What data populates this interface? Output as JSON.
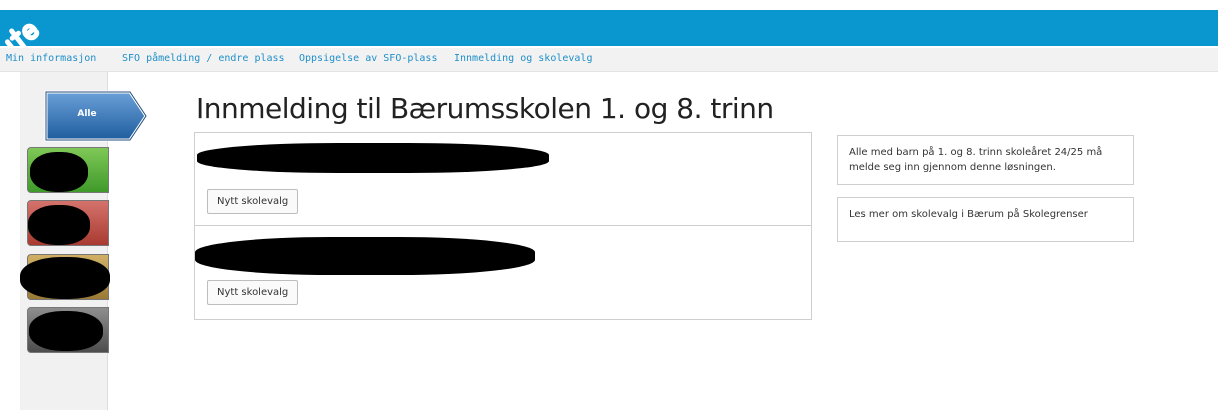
{
  "nav": {
    "items": [
      "Min informasjon",
      "SFO påmelding / endre plass",
      "Oppsigelse av SFO-plass",
      "Innmelding og skolevalg"
    ]
  },
  "sidebar": {
    "active_tab": "Alle",
    "tab_colors": [
      "#3f9a2a",
      "#a93a31",
      "#9a7a35",
      "#4d4d4d"
    ]
  },
  "main": {
    "title": "Innmelding til Bærumsskolen 1. og 8. trinn",
    "children": [
      {
        "button_label": "Nytt skolevalg"
      },
      {
        "button_label": "Nytt skolevalg"
      }
    ]
  },
  "info": {
    "notice": "Alle med barn på 1. og 8. trinn skoleåret 24/25 må melde seg inn gjennom denne løsningen.",
    "link_text": "Les mer om skolevalg i Bærum på Skolegrenser"
  },
  "colors": {
    "header": "#0a96cf",
    "link": "#1f8fc9",
    "active_tab": "#2f6fb0"
  }
}
